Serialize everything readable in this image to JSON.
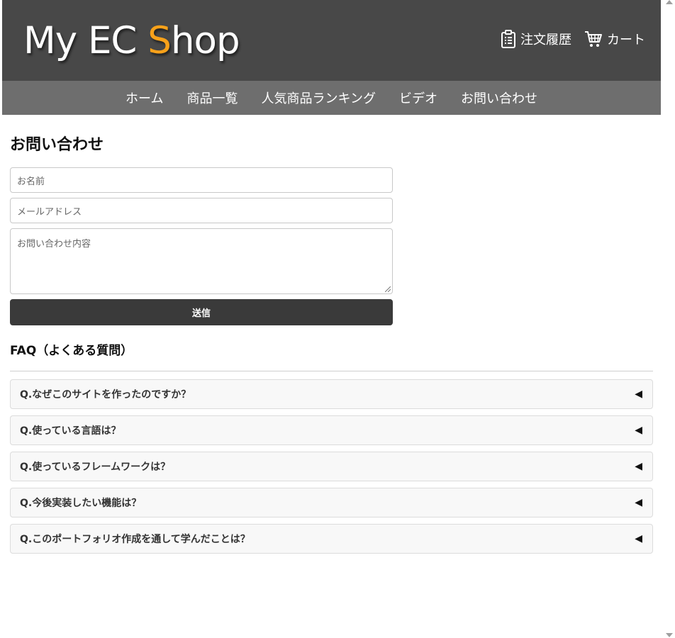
{
  "header": {
    "logo_prefix": "My EC ",
    "logo_accent": "S",
    "logo_suffix": "hop",
    "order_history_label": "注文履歴",
    "cart_label": "カート",
    "accent_color": "#f7a11a"
  },
  "nav": {
    "items": [
      {
        "label": "ホーム"
      },
      {
        "label": "商品一覧"
      },
      {
        "label": "人気商品ランキング"
      },
      {
        "label": "ビデオ"
      },
      {
        "label": "お問い合わせ"
      }
    ]
  },
  "contact": {
    "title": "お問い合わせ",
    "name_placeholder": "お名前",
    "email_placeholder": "メールアドレス",
    "message_placeholder": "お問い合わせ内容",
    "submit_label": "送信"
  },
  "faq": {
    "title": "FAQ（よくある質問）",
    "arrow_glyph": "◀",
    "items": [
      {
        "question": "Q.なぜこのサイトを作ったのですか？"
      },
      {
        "question": "Q.使っている言語は？"
      },
      {
        "question": "Q.使っているフレームワークは？"
      },
      {
        "question": "Q.今後実装したい機能は？"
      },
      {
        "question": "Q.このポートフォリオ作成を通して学んだことは？"
      }
    ]
  }
}
